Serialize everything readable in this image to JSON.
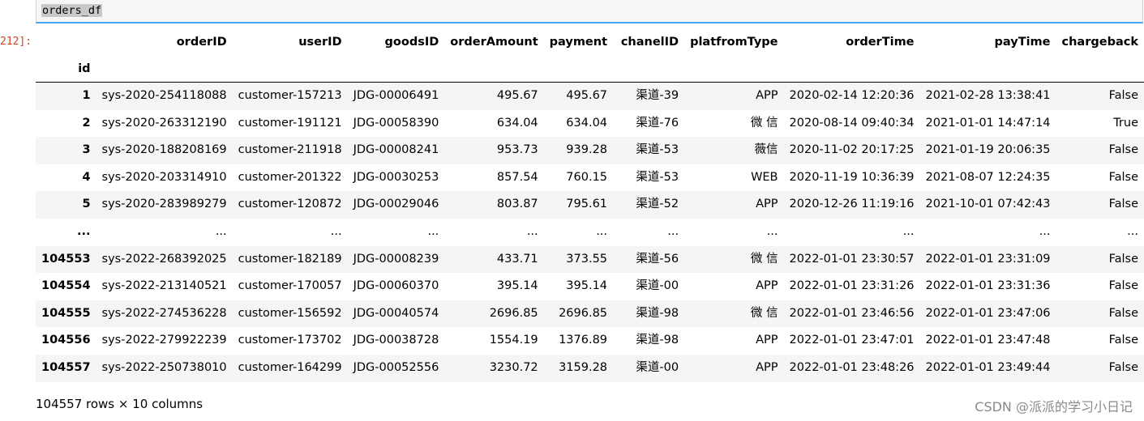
{
  "input": {
    "code": "orders_df"
  },
  "output": {
    "prompt": "212]:"
  },
  "table": {
    "index_name": "id",
    "columns": [
      "orderID",
      "userID",
      "goodsID",
      "orderAmount",
      "payment",
      "chanelID",
      "platfromType",
      "orderTime",
      "payTime",
      "chargeback"
    ],
    "rows": [
      [
        "1",
        "sys-2020-254118088",
        "customer-157213",
        "JDG-00006491",
        "495.67",
        "495.67",
        "渠道-39",
        "APP",
        "2020-02-14 12:20:36",
        "2021-02-28 13:38:41",
        "False"
      ],
      [
        "2",
        "sys-2020-263312190",
        "customer-191121",
        "JDG-00058390",
        "634.04",
        "634.04",
        "渠道-76",
        "微 信",
        "2020-08-14 09:40:34",
        "2021-01-01 14:47:14",
        "True"
      ],
      [
        "3",
        "sys-2020-188208169",
        "customer-211918",
        "JDG-00008241",
        "953.73",
        "939.28",
        "渠道-53",
        "薇信",
        "2020-11-02 20:17:25",
        "2021-01-19 20:06:35",
        "False"
      ],
      [
        "4",
        "sys-2020-203314910",
        "customer-201322",
        "JDG-00030253",
        "857.54",
        "760.15",
        "渠道-53",
        "WEB",
        "2020-11-19 10:36:39",
        "2021-08-07 12:24:35",
        "False"
      ],
      [
        "5",
        "sys-2020-283989279",
        "customer-120872",
        "JDG-00029046",
        "803.87",
        "795.61",
        "渠道-52",
        "APP",
        "2020-12-26 11:19:16",
        "2021-10-01 07:42:43",
        "False"
      ],
      [
        "...",
        "...",
        "...",
        "...",
        "...",
        "...",
        "...",
        "...",
        "...",
        "...",
        "..."
      ],
      [
        "104553",
        "sys-2022-268392025",
        "customer-182189",
        "JDG-00008239",
        "433.71",
        "373.55",
        "渠道-56",
        "微 信",
        "2022-01-01 23:30:57",
        "2022-01-01 23:31:09",
        "False"
      ],
      [
        "104554",
        "sys-2022-213140521",
        "customer-170057",
        "JDG-00060370",
        "395.14",
        "395.14",
        "渠道-00",
        "APP",
        "2022-01-01 23:31:26",
        "2022-01-01 23:31:36",
        "False"
      ],
      [
        "104555",
        "sys-2022-274536228",
        "customer-156592",
        "JDG-00040574",
        "2696.85",
        "2696.85",
        "渠道-98",
        "微 信",
        "2022-01-01 23:46:56",
        "2022-01-01 23:47:06",
        "False"
      ],
      [
        "104556",
        "sys-2022-279922239",
        "customer-173702",
        "JDG-00038728",
        "1554.19",
        "1376.89",
        "渠道-98",
        "APP",
        "2022-01-01 23:47:01",
        "2022-01-01 23:47:48",
        "False"
      ],
      [
        "104557",
        "sys-2022-250738010",
        "customer-164299",
        "JDG-00052556",
        "3230.72",
        "3159.28",
        "渠道-00",
        "APP",
        "2022-01-01 23:48:26",
        "2022-01-01 23:49:44",
        "False"
      ]
    ]
  },
  "shape_text": "104557 rows × 10 columns",
  "watermark": "CSDN @派派的学习小日记"
}
